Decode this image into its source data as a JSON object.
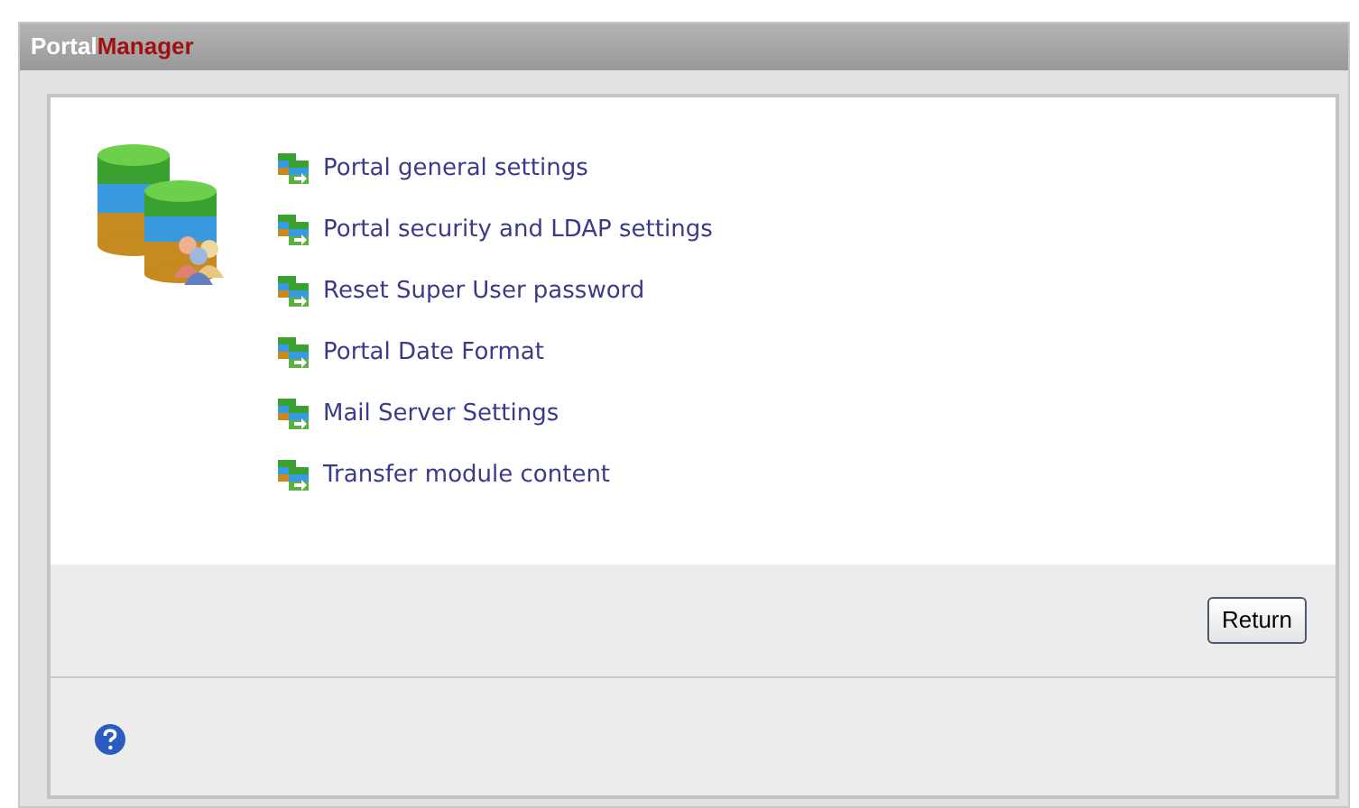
{
  "window": {
    "title_prefix": "Portal",
    "title_suffix": "Manager"
  },
  "links": [
    {
      "label": "Portal general settings"
    },
    {
      "label": "Portal security and LDAP settings"
    },
    {
      "label": "Reset Super User password"
    },
    {
      "label": "Portal Date Format"
    },
    {
      "label": "Mail Server Settings"
    },
    {
      "label": "Transfer module content"
    }
  ],
  "buttons": [
    "Return"
  ]
}
